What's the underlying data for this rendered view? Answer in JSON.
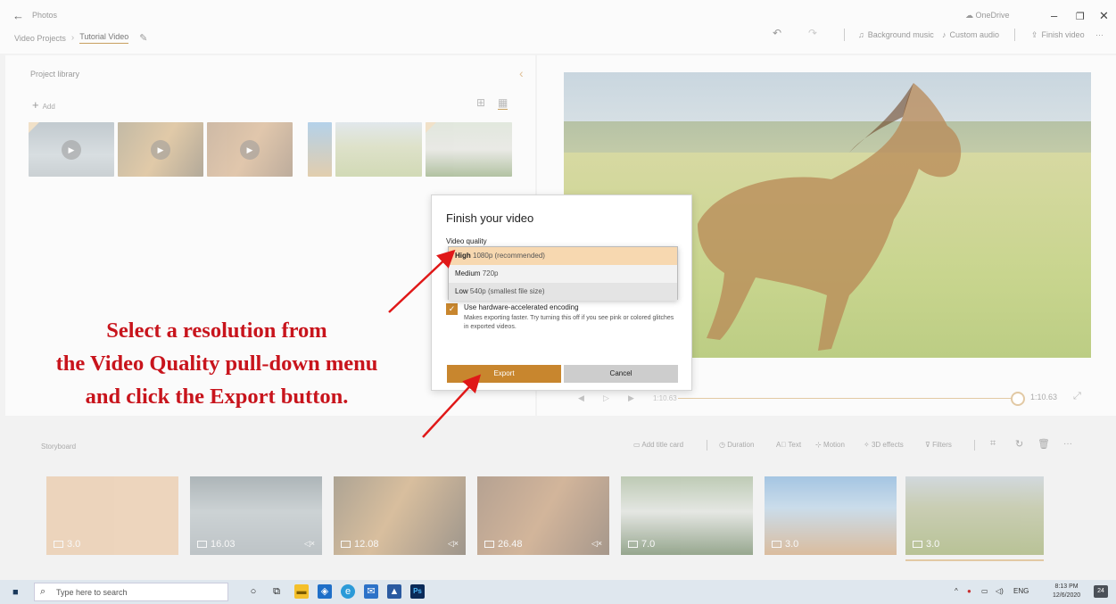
{
  "titlebar": {
    "back_glyph": "←",
    "app_name": "Photos",
    "breadcrumb_root": "Video Projects",
    "breadcrumb_sep": "›",
    "breadcrumb_current": "Tutorial Video",
    "edit_glyph": "✎",
    "onedrive": "OneDrive",
    "minimize": "–",
    "maximize": "❐",
    "close": "✕"
  },
  "toolbar": {
    "undo": "↶",
    "redo": "↷",
    "background_music": "Background music",
    "custom_audio": "Custom audio",
    "finish_video": "Finish video",
    "more": "···"
  },
  "library": {
    "title": "Project library",
    "add_label": "Add",
    "collapse": "‹",
    "view_grid_small": "⊞",
    "view_grid_large": "▦"
  },
  "preview": {
    "current_time": "1:10.63",
    "end_time": "1:10.63",
    "expand": "⤢",
    "rewind": "◀",
    "play": "▷",
    "forward": "▶"
  },
  "storyboard": {
    "title": "Storyboard",
    "add_title_card": "Add title card",
    "duration": "Duration",
    "text": "Text",
    "motion": "Motion",
    "effects_3d": "3D effects",
    "filters": "Filters",
    "more": "···",
    "clips": [
      {
        "duration": "3.0",
        "muted": ""
      },
      {
        "duration": "16.03",
        "muted": "◁×"
      },
      {
        "duration": "12.08",
        "muted": "◁×"
      },
      {
        "duration": "26.48",
        "muted": "◁×"
      },
      {
        "duration": "7.0",
        "muted": ""
      },
      {
        "duration": "3.0",
        "muted": ""
      },
      {
        "duration": "3.0",
        "muted": ""
      }
    ]
  },
  "dialog": {
    "title": "Finish your video",
    "quality_label": "Video quality",
    "options": [
      {
        "name": "High",
        "detail": "1080p (recommended)"
      },
      {
        "name": "Medium",
        "detail": "720p"
      },
      {
        "name": "Low",
        "detail": "540p (smallest file size)"
      }
    ],
    "hw_encoding_label": "Use hardware-accelerated encoding",
    "hw_encoding_desc": "Makes exporting faster. Try turning this off if you see pink or colored glitches in exported videos.",
    "export_label": "Export",
    "cancel_label": "Cancel"
  },
  "annotation": {
    "line1": "Select a resolution from",
    "line2": "the Video Quality pull-down menu",
    "line3": "and click the Export button."
  },
  "taskbar": {
    "search_placeholder": "Type here to search",
    "tray_lang": "ENG",
    "time": "8:13 PM",
    "date": "12/6/2020",
    "notifications": "24"
  },
  "colors": {
    "accent": "#c8862e",
    "annotation": "#c8141c",
    "selected_option": "#f7d8b0"
  }
}
